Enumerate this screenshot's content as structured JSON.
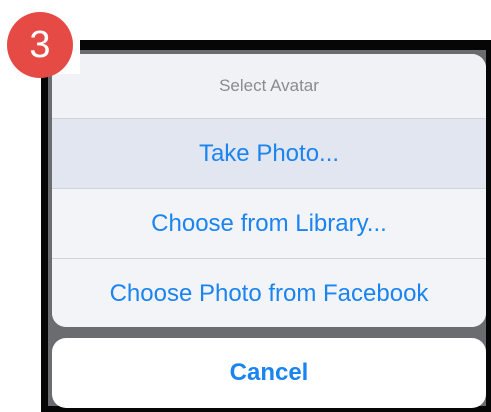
{
  "step_badge": {
    "number": "3",
    "color": "#e64a45"
  },
  "action_sheet": {
    "title": "Select Avatar",
    "actions": [
      {
        "label": "Take Photo..."
      },
      {
        "label": "Choose from Library..."
      },
      {
        "label": "Choose Photo from Facebook"
      }
    ],
    "cancel_label": "Cancel",
    "accent_color": "#1a84f0"
  },
  "underlay": {
    "icons": [
      "circle-icon",
      "person-icon",
      "help-icon"
    ]
  }
}
